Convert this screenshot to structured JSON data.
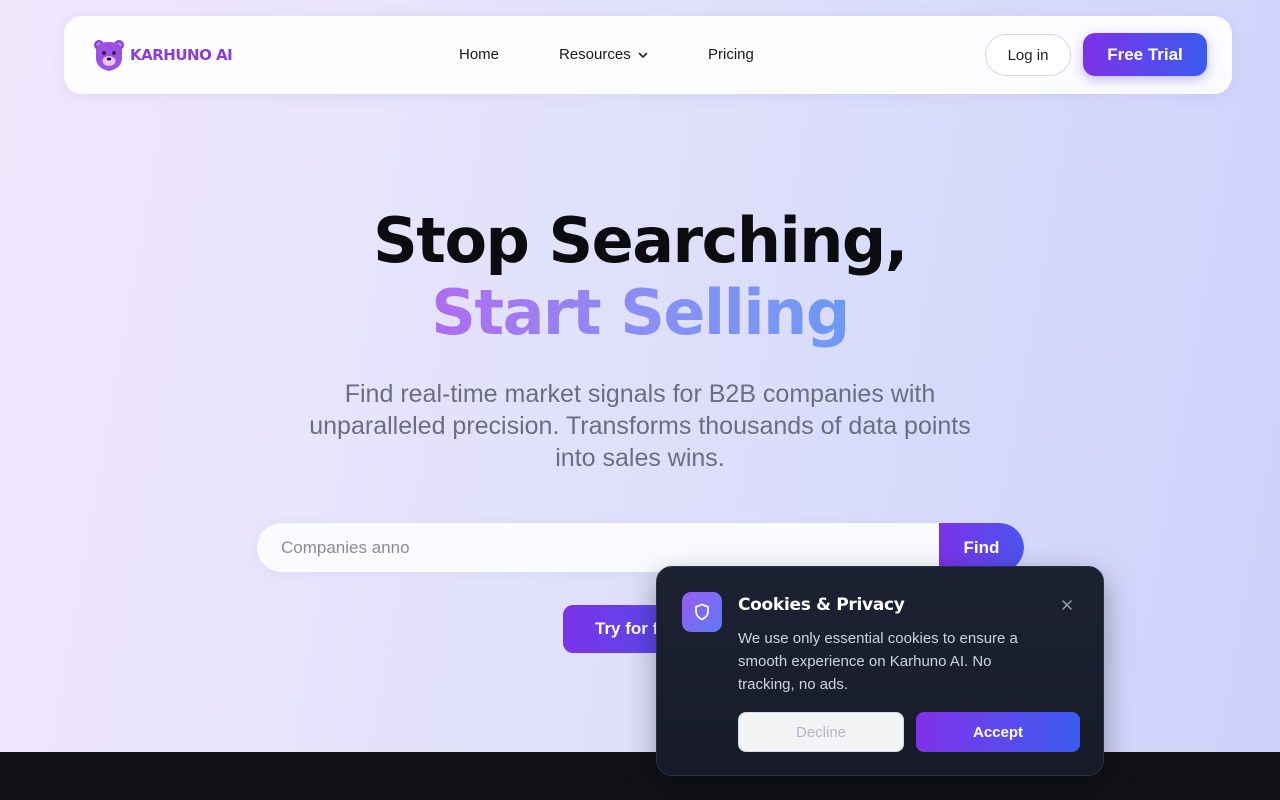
{
  "nav": {
    "logo_text": "KARHUNO AI",
    "links": [
      {
        "label": "Home"
      },
      {
        "label": "Resources",
        "icon": "chevron-down-icon"
      },
      {
        "label": "Pricing"
      }
    ],
    "login_label": "Log in",
    "trial_label": "Free Trial"
  },
  "hero": {
    "title_line1": "Stop Searching,",
    "title_line2": "Start Selling",
    "subtitle": "Find real-time market signals for B2B companies with unparalleled precision. Transforms thousands of data points into sales wins."
  },
  "search": {
    "placeholder": "Companies anno",
    "button_label": "Find"
  },
  "cta": {
    "try_label": "Try for f"
  },
  "cookie": {
    "icon": "shield-icon",
    "title": "Cookies & Privacy",
    "body": "We use only essential cookies to ensure a smooth experience on Karhuno AI. No tracking, no ads.",
    "decline_label": "Decline",
    "accept_label": "Accept"
  },
  "colors": {
    "accent_start": "#7d31ea",
    "accent_end": "#3a5bf0",
    "logo": "#8a3be0",
    "cookie_bg": "#1b2030"
  }
}
